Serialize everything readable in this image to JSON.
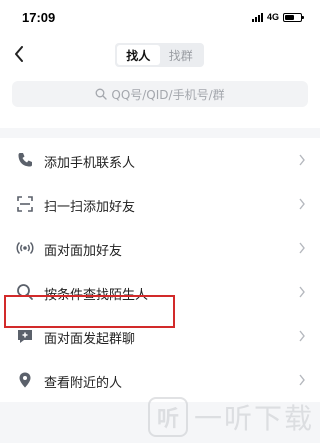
{
  "status_bar": {
    "time": "17:09",
    "network": "4G"
  },
  "nav": {
    "tabs": [
      {
        "label": "找人",
        "active": true
      },
      {
        "label": "找群",
        "active": false
      }
    ]
  },
  "search": {
    "placeholder": "QQ号/QID/手机号/群"
  },
  "menu": {
    "items": [
      {
        "label": "添加手机联系人",
        "icon": "phone-icon"
      },
      {
        "label": "扫一扫添加好友",
        "icon": "scan-icon"
      },
      {
        "label": "面对面加好友",
        "icon": "nearby-signal-icon"
      },
      {
        "label": "按条件查找陌生人",
        "icon": "search-icon"
      },
      {
        "label": "面对面发起群聊",
        "icon": "add-group-chat-icon",
        "highlighted": true
      },
      {
        "label": "查看附近的人",
        "icon": "location-icon"
      }
    ]
  },
  "watermark": {
    "logo_char": "听",
    "text": "一听下载"
  },
  "colors": {
    "highlight": "#d22a2a",
    "icon": "#5b616b",
    "background": "#f5f6f8"
  }
}
